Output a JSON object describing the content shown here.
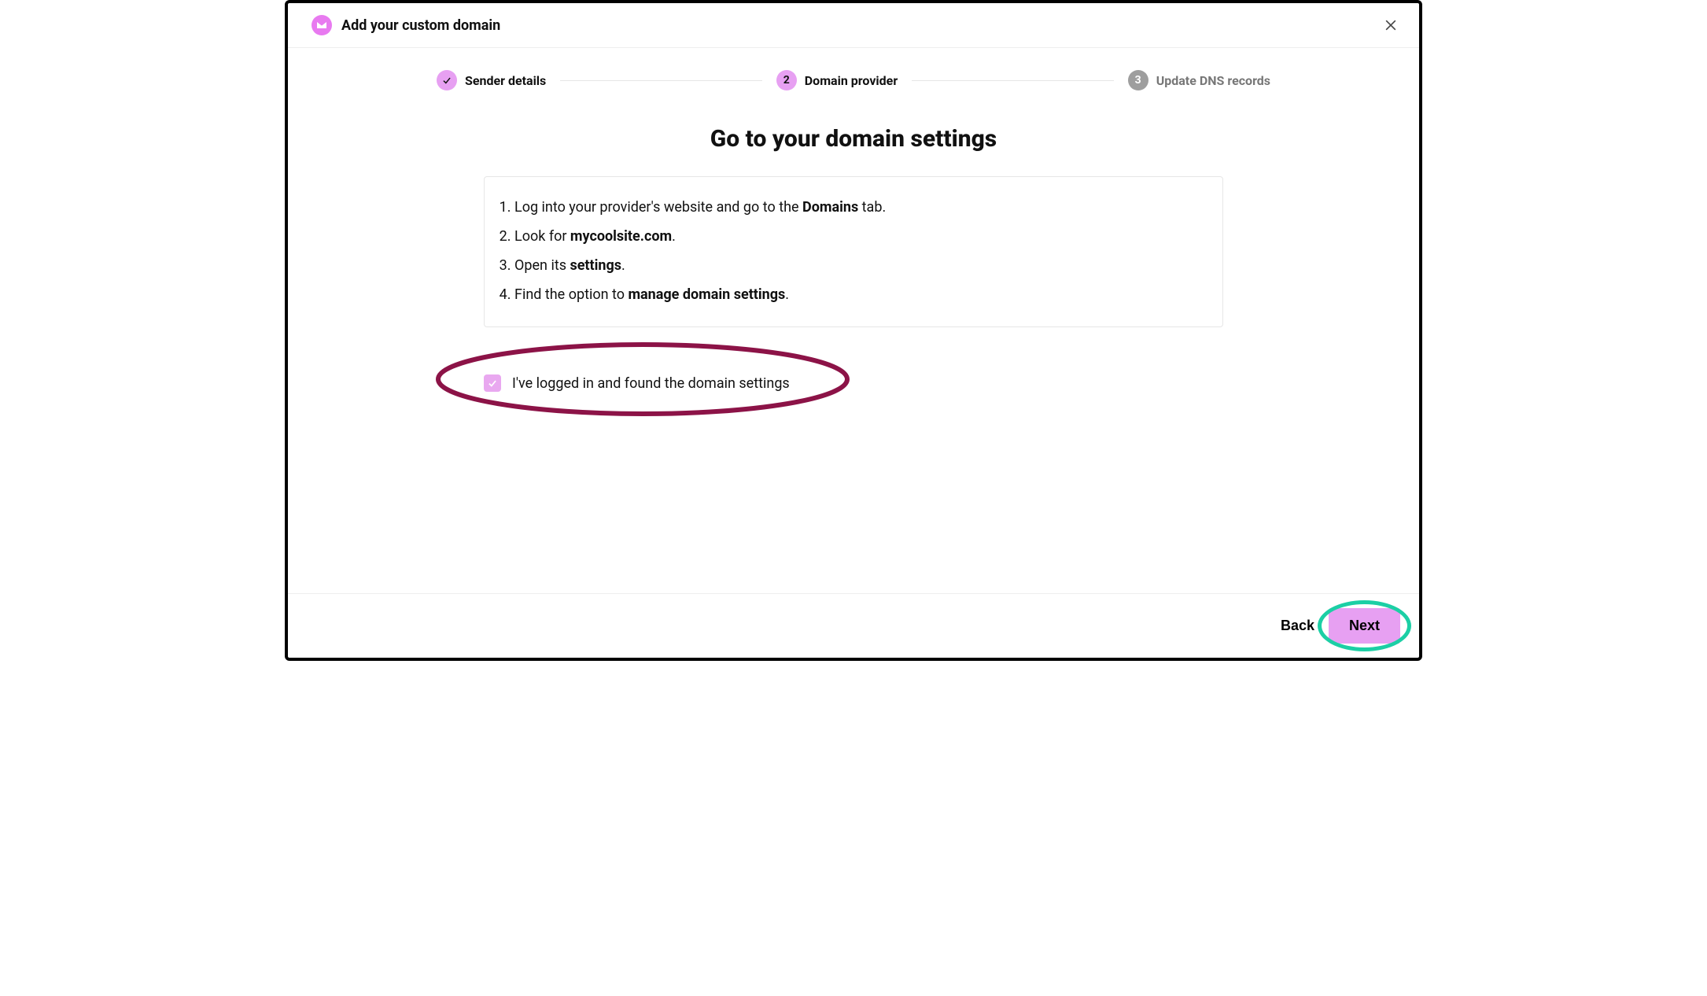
{
  "header": {
    "title": "Add your custom domain"
  },
  "stepper": {
    "step1": {
      "label": "Sender details"
    },
    "step2": {
      "num": "2",
      "label": "Domain provider"
    },
    "step3": {
      "num": "3",
      "label": "Update DNS records"
    }
  },
  "main": {
    "title": "Go to your domain settings",
    "instructions": {
      "i1_pre": "Log into your provider's website and go to the ",
      "i1_bold": "Domains",
      "i1_post": " tab.",
      "i2_pre": "Look for ",
      "i2_bold": "mycoolsite.com",
      "i2_post": ".",
      "i3_pre": "Open its ",
      "i3_bold": "settings",
      "i3_post": ".",
      "i4_pre": "Find the option to ",
      "i4_bold": "manage domain settings",
      "i4_post": "."
    },
    "confirm_label": "I've logged in and found the domain settings"
  },
  "footer": {
    "back": "Back",
    "next": "Next"
  }
}
